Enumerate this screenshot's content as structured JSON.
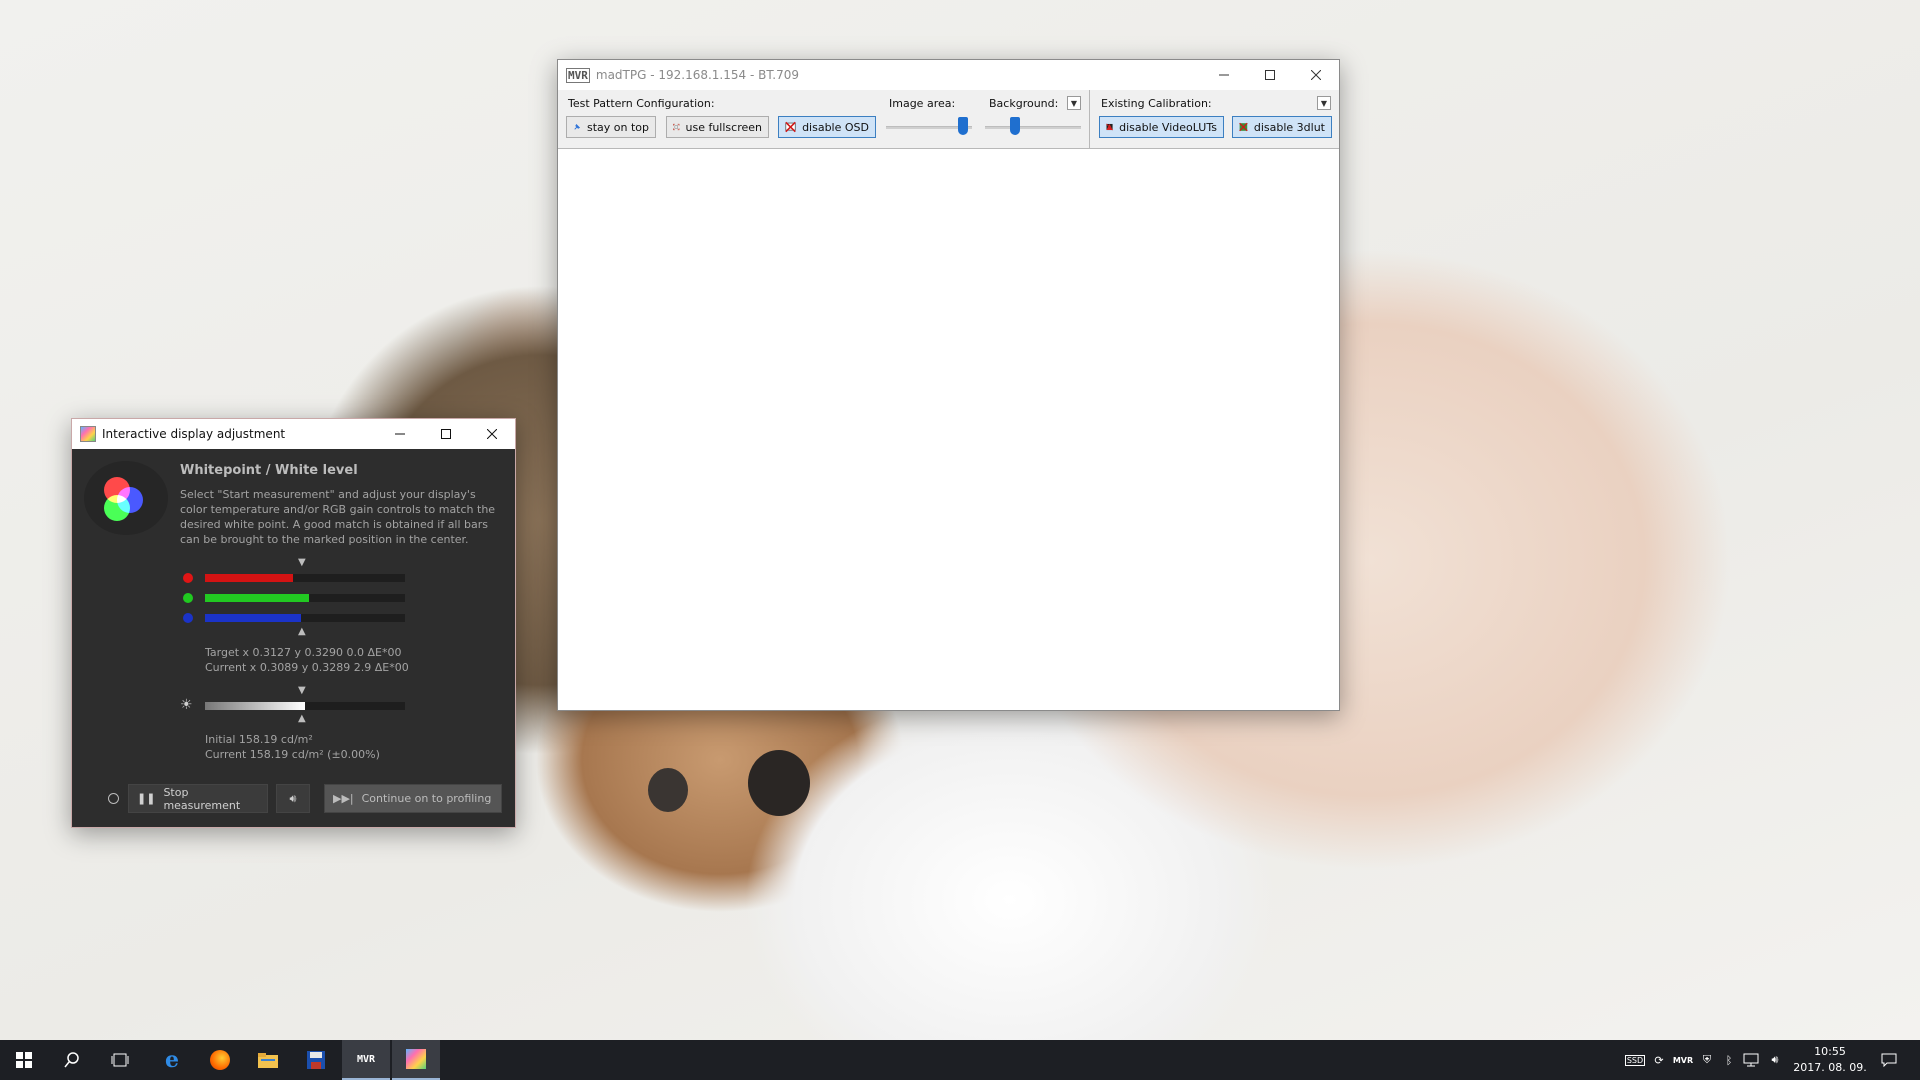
{
  "colors": {
    "accent_blue": "#1f6fcf",
    "red_bar": "#d31313",
    "green_bar": "#22c922",
    "blue_bar": "#1b33c8",
    "dark_bg": "#2d2d2d",
    "taskbar": "#1d1f24"
  },
  "madtpg": {
    "title": "madTPG  -  192.168.1.154  -  BT.709",
    "test_pattern_label": "Test Pattern Configuration:",
    "stay_on_top": "stay on top",
    "use_fullscreen": "use fullscreen",
    "disable_osd": "disable OSD",
    "image_area_label": "Image area:",
    "background_label": "Background:",
    "existing_calibration_label": "Existing Calibration:",
    "disable_videoluts": "disable VideoLUTs",
    "disable_3dlut": "disable 3dlut",
    "image_area_level": 0.85,
    "background_level": 0.3
  },
  "ida": {
    "title": "Interactive display adjustment",
    "heading": "Whitepoint / White level",
    "description": "Select \"Start measurement\" and adjust your display's color temperature and/or RGB gain controls to match the desired white point. A good match is obtained if all bars can be brought to the marked position in the center.",
    "bars": {
      "red": 0.44,
      "green": 0.52,
      "blue": 0.48,
      "luminance": 0.5
    },
    "target_line": "Target x 0.3127 y 0.3290 0.0 ΔE*00",
    "current_line": "Current x 0.3089 y 0.3289 2.9 ΔE*00",
    "initial_lum": "Initial 158.19 cd/m²",
    "current_lum": "Current 158.19 cd/m² (±0.00%)",
    "stop_button": "Stop measurement",
    "continue_button": "Continue on to profiling"
  },
  "taskbar": {
    "time": "10:55",
    "date": "2017. 08. 09.",
    "icons": [
      "windows-start-icon",
      "search-icon",
      "task-view-icon",
      "edge-icon",
      "firefox-icon",
      "file-explorer-icon",
      "save-app-icon",
      "madvr-icon",
      "displaycal-icon"
    ]
  }
}
